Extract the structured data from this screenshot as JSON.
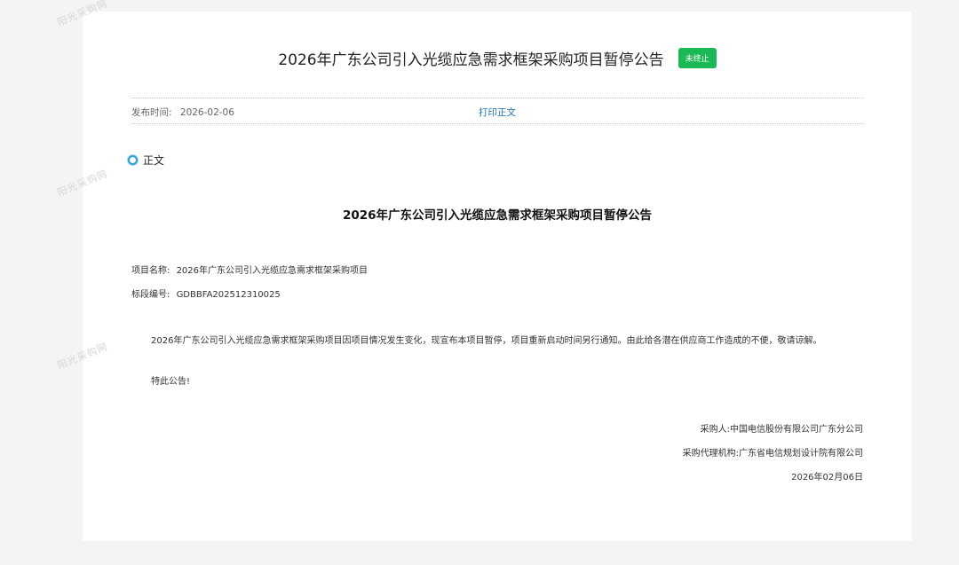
{
  "watermark": "阳光采购网",
  "header": {
    "title": "2026年广东公司引入光缆应急需求框架采购项目暂停公告",
    "status_badge": "未终止"
  },
  "meta": {
    "publish_label": "发布时间:",
    "publish_date": "2026-02-06",
    "print_link": "打印正文"
  },
  "section": {
    "label": "正文"
  },
  "document": {
    "title": "2026年广东公司引入光缆应急需求框架采购项目暂停公告",
    "project_name_label": "项目名称:",
    "project_name": "2026年广东公司引入光缆应急需求框架采购项目",
    "section_no_label": "标段编号:",
    "section_no": "GDBBFA202512310025",
    "body": "2026年广东公司引入光缆应急需求框架采购项目因项目情况发生变化，现宣布本项目暂停，项目重新启动时间另行通知。由此给各潜在供应商工作造成的不便，敬请谅解。",
    "notice": "特此公告!",
    "purchaser": "采购人:中国电信股份有限公司广东分公司",
    "agency": "采购代理机构:广东省电信规划设计院有限公司",
    "date": "2026年02月06日"
  },
  "colors": {
    "badge": "#19b955",
    "link": "#1a6fc0",
    "section_dot": "#2a9fd8"
  }
}
